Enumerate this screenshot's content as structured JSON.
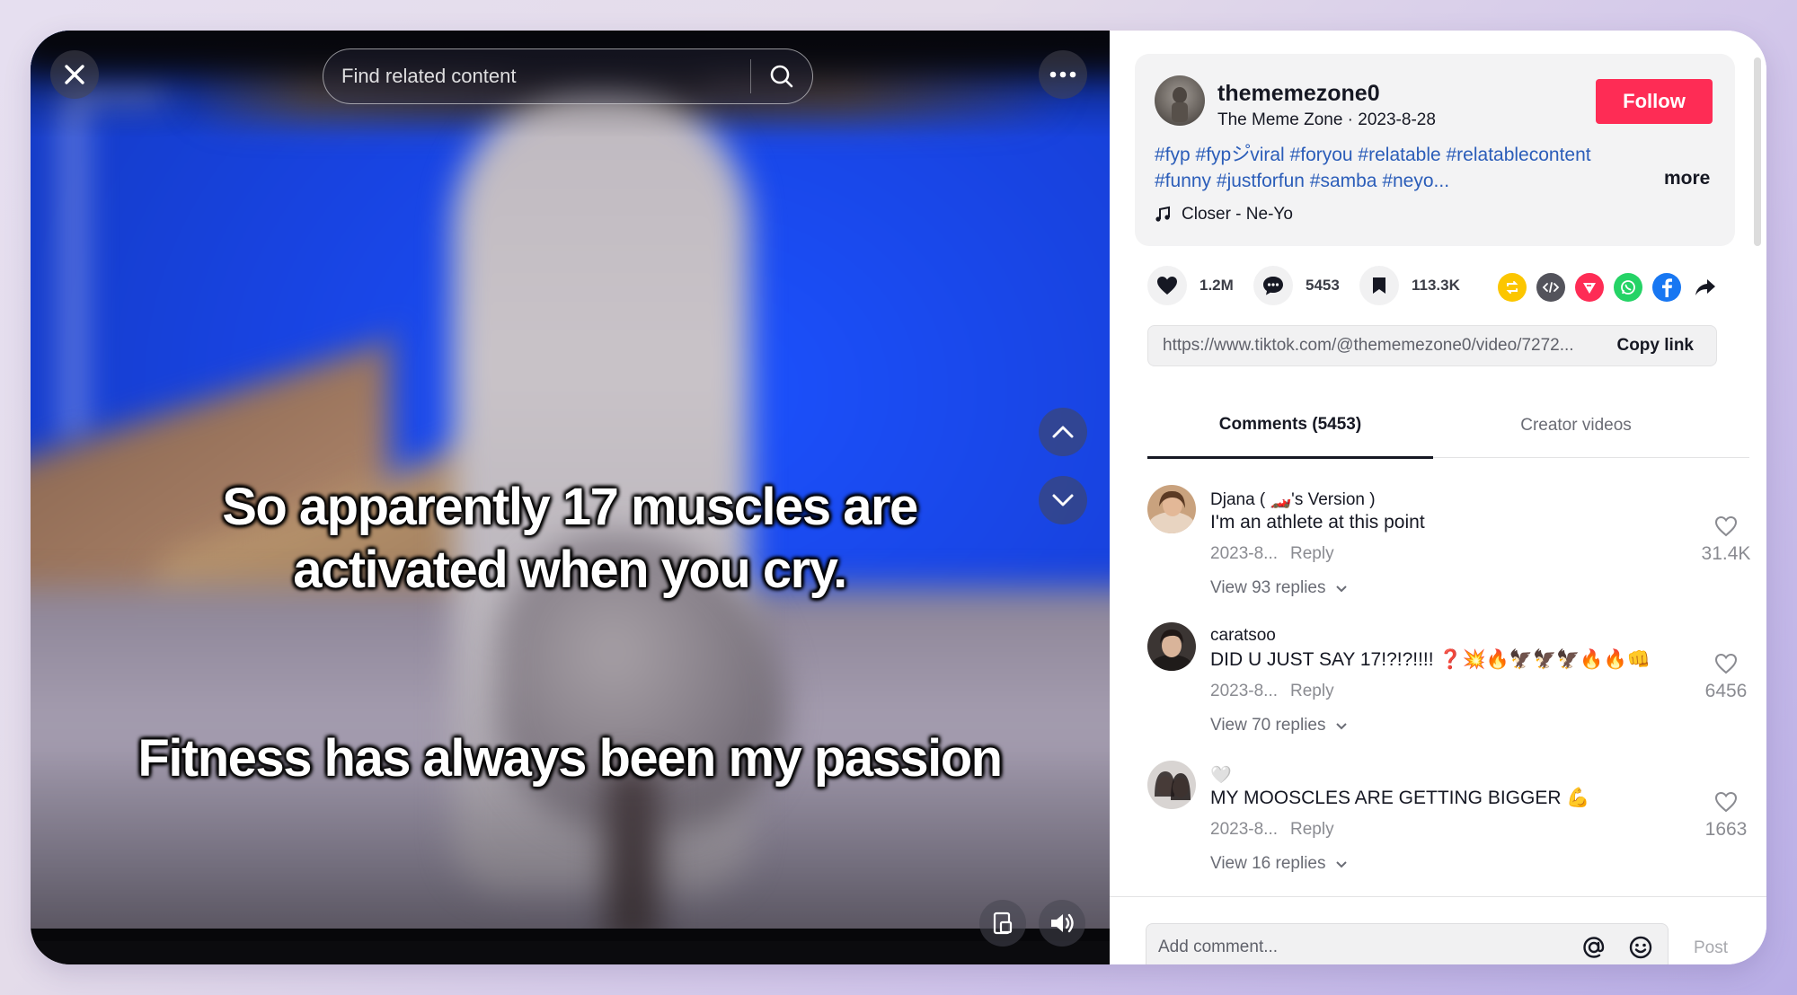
{
  "video": {
    "search_placeholder": "Find related content",
    "caption_line1": "So apparently 17 muscles are activated when you cry.",
    "caption_line2": "Fitness has always been my passion",
    "icons": {
      "close": "close-icon",
      "search": "search-icon",
      "more": "ellipsis-icon",
      "up": "chevron-up-icon",
      "down": "chevron-down-icon",
      "floating": "floating-player-icon",
      "volume": "volume-icon"
    }
  },
  "post": {
    "author": "thememezone0",
    "subtitle": "The Meme Zone · 2023-8-28",
    "follow_label": "Follow",
    "hashtags_line1": "#fyp #fypシ゚viral #foryou #relatable #relatablecontent",
    "hashtags_line2": "#funny #justforfun #samba #neyo...",
    "more_label": "more",
    "music": "Closer - Ne-Yo",
    "likes": "1.2M",
    "comments": "5453",
    "saves": "113.3K",
    "share_targets": [
      "repost-icon",
      "embed-icon",
      "send-icon",
      "whatsapp-icon",
      "facebook-icon",
      "share-arrow-icon"
    ],
    "url": "https://www.tiktok.com/@thememezone0/video/7272...",
    "copy_link_label": "Copy link"
  },
  "tabs": [
    {
      "label": "Comments (5453)",
      "active": true
    },
    {
      "label": "Creator videos",
      "active": false
    }
  ],
  "comments": [
    {
      "name": "Djana ( 🏎️'s Version )",
      "text": "I'm an athlete at this point",
      "date": "2023-8...",
      "reply": "Reply",
      "view_replies": "View 93 replies",
      "likes": "31.4K"
    },
    {
      "name": "caratsoo",
      "text": "DID U JUST SAY 17!?!?!!!! ❓💥🔥🦅🦅🦅🔥🔥👊",
      "date": "2023-8...",
      "reply": "Reply",
      "view_replies": "View 70 replies",
      "likes": "6456"
    },
    {
      "name": "🤍",
      "text": "MY MOOSCLES ARE GETTING BIGGER 💪",
      "date": "2023-8...",
      "reply": "Reply",
      "view_replies": "View 16 replies",
      "likes": "1663"
    }
  ],
  "footer": {
    "placeholder": "Add comment...",
    "post_label": "Post"
  },
  "colors": {
    "brand": "#fe2c55",
    "hashtag": "#2b5db9",
    "video_blue": "#1843e0"
  }
}
